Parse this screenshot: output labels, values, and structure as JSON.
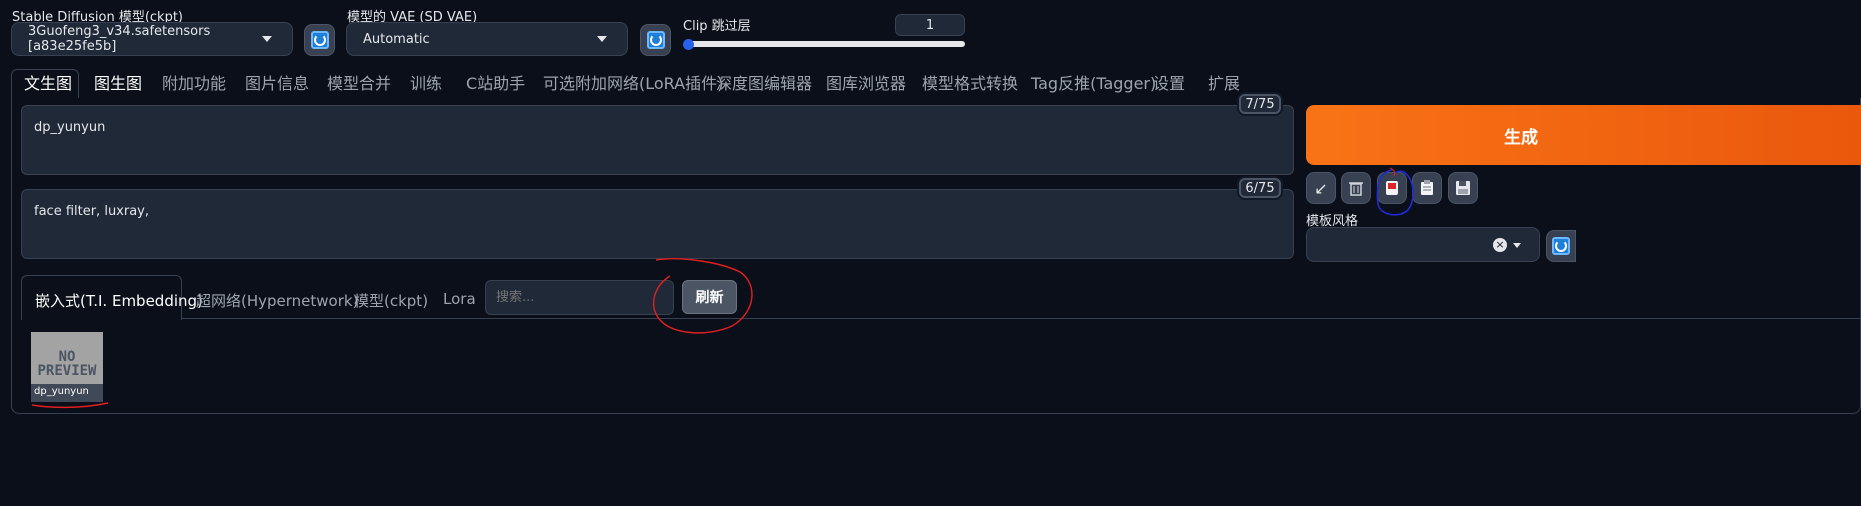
{
  "top": {
    "ckpt_label": "Stable Diffusion 模型(ckpt)",
    "ckpt_value": "3Guofeng3_v34.safetensors [a83e25fe5b]",
    "vae_label": "模型的 VAE (SD VAE)",
    "vae_value": "Automatic",
    "clip_label": "Clip 跳过层",
    "clip_value": "1",
    "clip_slider_fraction": 0.0
  },
  "tabs": [
    "文生图",
    "图生图",
    "附加功能",
    "图片信息",
    "模型合并",
    "训练",
    "C站助手",
    "可选附加网络(LoRA插件)",
    "深度图编辑器",
    "图库浏览器",
    "模型格式转换",
    "Tag反推(Tagger)",
    "设置",
    "扩展"
  ],
  "prompt": {
    "text": "dp_yunyun",
    "counter": "7/75"
  },
  "negative": {
    "text": "face filter, luxray,",
    "counter": "6/75"
  },
  "generate_label": "生成",
  "tool_icons": [
    "arrow-icon",
    "trash-icon",
    "extra-networks-icon",
    "clipboard-icon",
    "save-icon"
  ],
  "style_label": "模板风格",
  "subtabs": [
    "嵌入式(T.I. Embedding)",
    "超网络(Hypernetwork)",
    "模型(ckpt)",
    "Lora"
  ],
  "search_placeholder": "搜索...",
  "refresh_label": "刷新",
  "card": {
    "preview_text": "NO\nPREVIEW",
    "name": "dp_yunyun"
  },
  "colors": {
    "accent": "#f97316",
    "bg": "#0b0f19",
    "annotation_red": "#e02020",
    "annotation_blue": "#1e2bd8"
  }
}
